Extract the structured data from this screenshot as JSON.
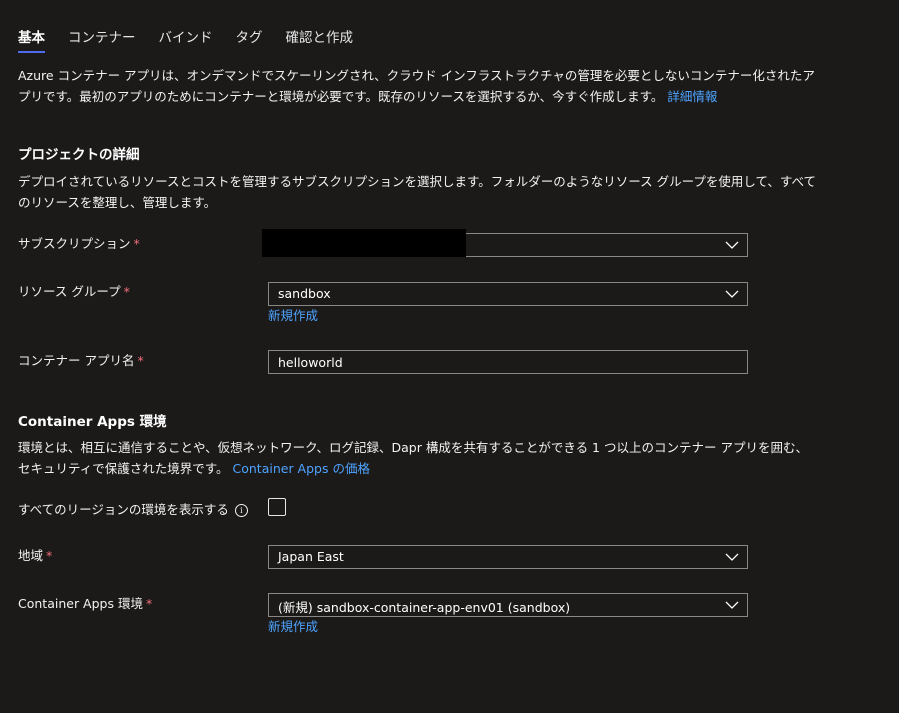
{
  "tabs": [
    {
      "label": "基本",
      "active": true
    },
    {
      "label": "コンテナー"
    },
    {
      "label": "バインド"
    },
    {
      "label": "タグ"
    },
    {
      "label": "確認と作成"
    }
  ],
  "intro": {
    "text": "Azure コンテナー アプリは、オンデマンドでスケーリングされ、クラウド インフラストラクチャの管理を必要としないコンテナー化されたアプリです。最初のアプリのためにコンテナーと環境が必要です。既存のリソースを選択するか、今すぐ作成します。",
    "link": "詳細情報"
  },
  "project": {
    "heading": "プロジェクトの詳細",
    "description": "デプロイされているリソースとコストを管理するサブスクリプションを選択します。フォルダーのようなリソース グループを使用して、すべてのリソースを整理し、管理します。",
    "subscription_label": "サブスクリプション",
    "subscription_value": "",
    "resource_group_label": "リソース グループ",
    "resource_group_value": "sandbox",
    "resource_group_create": "新規作成",
    "app_name_label": "コンテナー アプリ名",
    "app_name_value": "helloworld"
  },
  "environment": {
    "heading": "Container Apps 環境",
    "description": "環境とは、相互に通信することや、仮想ネットワーク、ログ記録、Dapr 構成を共有することができる 1 つ以上のコンテナー アプリを囲む、セキュリティで保護された境界です。",
    "pricing_link": "Container Apps の価格",
    "show_all_regions_label": "すべてのリージョンの環境を表示する",
    "show_all_regions_checked": false,
    "region_label": "地域",
    "region_value": "Japan East",
    "env_label": "Container Apps 環境",
    "env_value": "(新規) sandbox-container-app-env01 (sandbox)",
    "env_create": "新規作成"
  },
  "required_marker": "*",
  "colors": {
    "accent": "#4f6bed",
    "link": "#4ea3ff",
    "required": "#f1707b",
    "background": "#1b1a19"
  },
  "icons": {
    "dropdown": "chevron-down-icon",
    "info": "info-icon"
  }
}
